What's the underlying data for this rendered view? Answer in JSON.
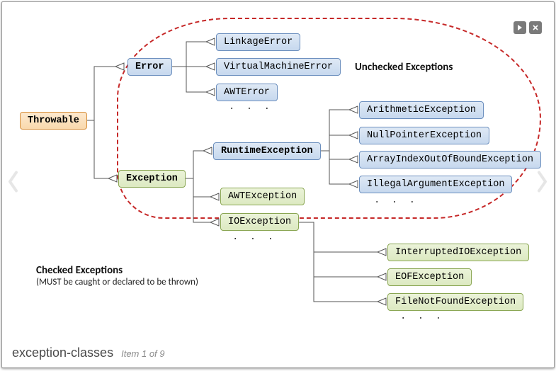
{
  "footer": {
    "title": "exception-classes",
    "position": "Item 1 of 9"
  },
  "group_label": "Unchecked Exceptions",
  "checked_label_title": "Checked Exceptions",
  "checked_label_sub": "(MUST be caught or declared to be thrown)",
  "nodes": {
    "throwable": "Throwable",
    "error": "Error",
    "linkage": "LinkageError",
    "vmerror": "VirtualMachineError",
    "awterror": "AWTError",
    "exception": "Exception",
    "runtime": "RuntimeException",
    "arith": "ArithmeticException",
    "npe": "NullPointerException",
    "aioobe": "ArrayIndexOutOfBoundException",
    "iae": "IllegalArgumentException",
    "awtex": "AWTException",
    "ioex": "IOException",
    "interrupted": "InterruptedIOException",
    "eof": "EOFException",
    "fnf": "FileNotFoundException"
  },
  "ellipsis": ". . ."
}
